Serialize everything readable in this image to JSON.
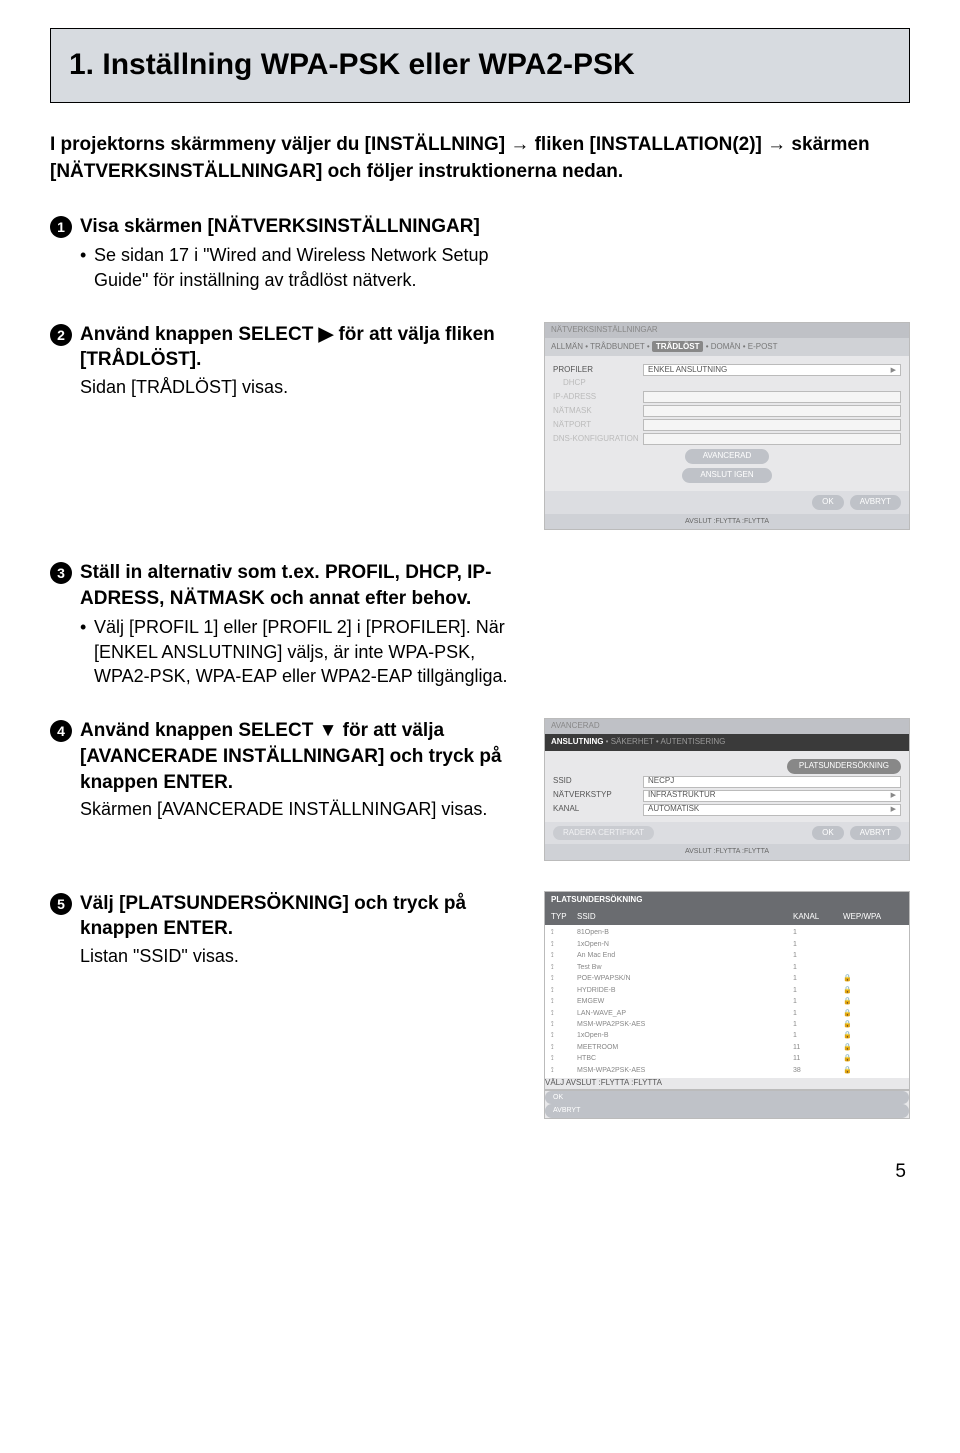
{
  "title": "1. Inställning WPA-PSK eller WPA2-PSK",
  "intro": "I projektorns skärmmeny väljer du [INSTÄLLNING] → fliken [INSTALLATION(2)] → skärmen [NÄTVERKSINSTÄLLNINGAR] och följer instruktionerna nedan.",
  "steps": {
    "s1": {
      "title": "Visa skärmen [NÄTVERKSINSTÄLLNINGAR]",
      "bullet": "Se sidan 17 i \"Wired and Wireless Network Setup Guide\" för inställning av trådlöst nätverk."
    },
    "s2": {
      "title": "Använd knappen SELECT ▶ för att välja fliken [TRÅDLÖST].",
      "plain": "Sidan [TRÅDLÖST] visas."
    },
    "s3": {
      "title": "Ställ in alternativ som t.ex. PROFIL, DHCP, IP-ADRESS, NÄTMASK och annat efter behov.",
      "bullet": "Välj [PROFIL 1] eller [PROFIL 2] i [PROFILER]. När [ENKEL ANSLUTNING] väljs, är inte WPA-PSK, WPA2-PSK, WPA-EAP eller WPA2-EAP tillgängliga."
    },
    "s4": {
      "title": "Använd knappen SELECT ▼ för att välja [AVANCERADE INSTÄLLNINGAR] och tryck på knappen ENTER.",
      "plain": "Skärmen [AVANCERADE INSTÄLLNINGAR] visas."
    },
    "s5": {
      "title": "Välj [PLATSUNDERSÖKNING] och tryck på knappen ENTER.",
      "plain": "Listan \"SSID\" visas."
    }
  },
  "dialog1": {
    "breadcrumb_title": "NÄTVERKSINSTÄLLNINGAR",
    "crumb1": "ALLMÄN",
    "crumb2": "TRÅDBUNDET",
    "crumb3_active": "TRÅDLÖST",
    "crumb4": "DOMÄN",
    "crumb5": "E-POST",
    "profiler": "PROFILER",
    "profiler_val": "ENKEL ANSLUTNING",
    "dhcp": "DHCP",
    "ip": "IP-ADRESS",
    "mask": "NÄTMASK",
    "port": "NÄTPORT",
    "dns": "DNS-KONFIGURATION",
    "avancerad": "AVANCERAD",
    "reconnect": "ANSLUT IGEN",
    "ok": "OK",
    "avbryt": "AVBRYT",
    "footer": "AVSLUT   :FLYTTA   :FLYTTA"
  },
  "dialog2": {
    "title": "AVANCERAD",
    "tab1_active": "ANSLUTNING",
    "tab2": "SÄKERHET",
    "tab3": "AUTENTISERING",
    "survey_btn": "PLATSUNDERSÖKNING",
    "ssid_lbl": "SSID",
    "ssid_val": "NECPJ",
    "nettype_lbl": "NÄTVERKSTYP",
    "nettype_val": "INFRASTRUKTUR",
    "kanal_lbl": "KANAL",
    "kanal_val": "AUTOMATISK",
    "clear_cert": "RADERA CERTIFIKAT",
    "ok": "OK",
    "avbryt": "AVBRYT",
    "footer": "AVSLUT   :FLYTTA   :FLYTTA"
  },
  "dialog3": {
    "title": "PLATSUNDERSÖKNING",
    "col_typ": "TYP",
    "col_ssid": "SSID",
    "col_kanal": "KANAL",
    "col_wep": "WEP/WPA",
    "ok": "OK",
    "avbryt": "AVBRYT",
    "rows": [
      {
        "ssid": "81Open-B",
        "kanal": "1",
        "wep": ""
      },
      {
        "ssid": "1xOpen-N",
        "kanal": "1",
        "wep": ""
      },
      {
        "ssid": "An Mac End",
        "kanal": "1",
        "wep": ""
      },
      {
        "ssid": "Test Bw",
        "kanal": "1",
        "wep": ""
      },
      {
        "ssid": "POE-WPAPSK/N",
        "kanal": "1",
        "wep": "🔒"
      },
      {
        "ssid": "HYDRIDE-B",
        "kanal": "1",
        "wep": "🔒"
      },
      {
        "ssid": "EMGEW",
        "kanal": "1",
        "wep": "🔒"
      },
      {
        "ssid": "LAN-WAVE_AP",
        "kanal": "1",
        "wep": "🔒"
      },
      {
        "ssid": "MSM-WPA2PSK-AES",
        "kanal": "1",
        "wep": "🔒"
      },
      {
        "ssid": "1xOpen-B",
        "kanal": "1",
        "wep": "🔒"
      },
      {
        "ssid": "MEETROOM",
        "kanal": "11",
        "wep": "🔒"
      },
      {
        "ssid": "HTBC",
        "kanal": "11",
        "wep": "🔒"
      },
      {
        "ssid": "MSM-WPA2PSK-AES",
        "kanal": "38",
        "wep": "🔒"
      }
    ],
    "footer": "VÄLJ   AVSLUT   :FLYTTA   :FLYTTA"
  },
  "page_number": "5"
}
